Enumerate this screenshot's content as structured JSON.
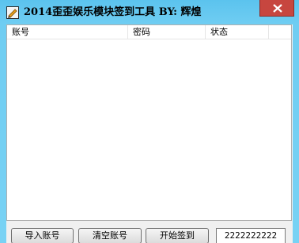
{
  "window": {
    "title": "2014歪歪娱乐模块签到工具  BY: 辉煌",
    "icon": "pencil-app-icon",
    "close_icon": "close-icon"
  },
  "list": {
    "columns": [
      "账号",
      "密码",
      "状态"
    ],
    "rows": []
  },
  "buttons": {
    "import": "导入账号",
    "clear": "清空账号",
    "start": "开始签到"
  },
  "count_field": {
    "value": "2222222222"
  },
  "colors": {
    "titlebar": "#6cc8ee",
    "close_button": "#c7463f",
    "client_bg": "#f0f0f0"
  }
}
